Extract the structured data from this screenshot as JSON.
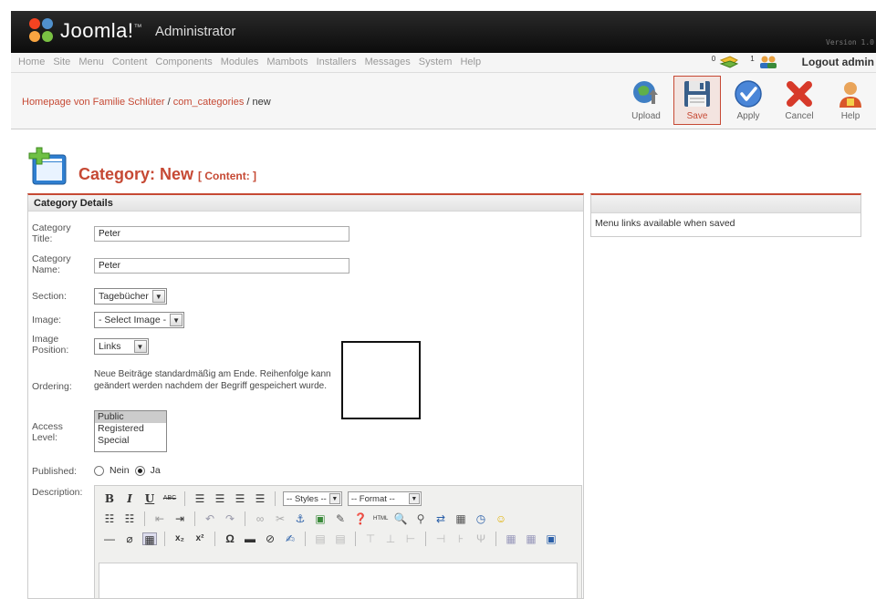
{
  "header": {
    "brand": "Joomla!",
    "tm": "™",
    "subtitle": "Administrator",
    "version": "Version 1.0"
  },
  "menu": {
    "items": [
      "Home",
      "Site",
      "Menu",
      "Content",
      "Components",
      "Modules",
      "Mambots",
      "Installers",
      "Messages",
      "System",
      "Help"
    ],
    "mail_count": "0",
    "users_count": "1",
    "logout": "Logout admin"
  },
  "breadcrumb": {
    "site": "Homepage von Familie Schlüter",
    "sep1": " / ",
    "component": "com_categories",
    "sep2": " / ",
    "action": "new"
  },
  "toolbar": {
    "buttons": [
      {
        "label": "Upload",
        "icon": "upload-icon"
      },
      {
        "label": "Save",
        "icon": "save-icon"
      },
      {
        "label": "Apply",
        "icon": "apply-icon"
      },
      {
        "label": "Cancel",
        "icon": "cancel-icon"
      },
      {
        "label": "Help",
        "icon": "help-icon"
      }
    ]
  },
  "page": {
    "title": "Category: New",
    "subtitle": "[ Content: ]"
  },
  "details": {
    "heading": "Category Details",
    "title_label": "Category Title:",
    "title_value": "Peter",
    "name_label": "Category Name:",
    "name_value": "Peter",
    "section_label": "Section:",
    "section_value": "Tagebücher",
    "image_label": "Image:",
    "image_value": "- Select Image -",
    "position_label": "Image Position:",
    "position_value": "Links",
    "ordering_label": "Ordering:",
    "ordering_text": "Neue Beiträge standardmäßig am Ende. Reihenfolge kann geändert werden nachdem der Begriff gespeichert wurde.",
    "access_label": "Access Level:",
    "access_options": [
      "Public",
      "Registered",
      "Special"
    ],
    "published_label": "Published:",
    "published_no": "Nein",
    "published_yes": "Ja",
    "description_label": "Description:"
  },
  "editor": {
    "styles": "-- Styles --",
    "format": "-- Format --"
  },
  "menulinks": {
    "text": "Menu links available when saved"
  },
  "colors": {
    "accent": "#c64934",
    "header_bg": "#111111"
  }
}
